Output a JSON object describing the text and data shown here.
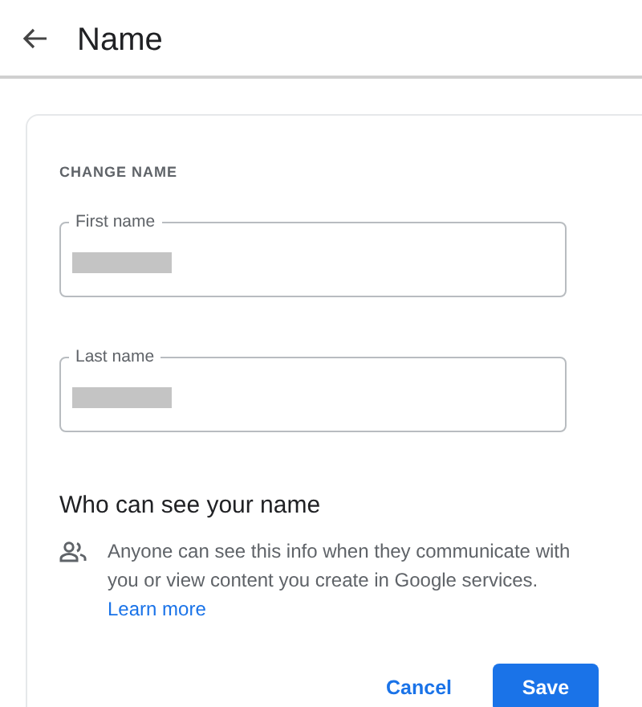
{
  "header": {
    "title": "Name"
  },
  "card": {
    "heading": "CHANGE NAME",
    "fields": [
      {
        "label": "First name",
        "value_redacted": true
      },
      {
        "label": "Last name",
        "value_redacted": true
      }
    ],
    "visibility": {
      "title": "Who can see your name",
      "text": "Anyone can see this info when they communicate with you or view content you create in Google services.",
      "link": "Learn more"
    },
    "buttons": [
      {
        "label": "Cancel",
        "kind": "text"
      },
      {
        "label": "Save",
        "kind": "filled"
      }
    ]
  }
}
